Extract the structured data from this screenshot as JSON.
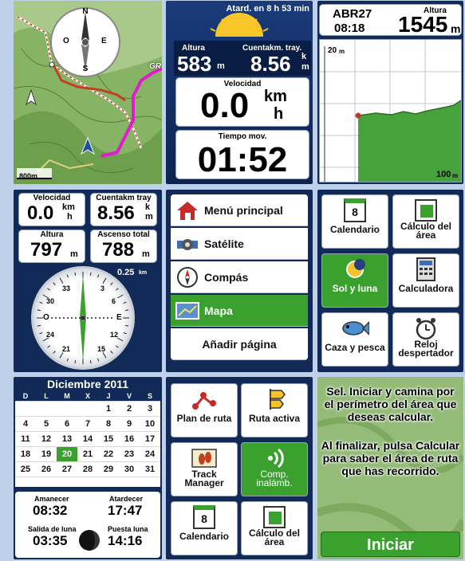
{
  "map": {
    "scale": "800m",
    "label_gr": "GR",
    "compass_n": "N",
    "compass_s": "S",
    "compass_e": "E",
    "compass_o": "O"
  },
  "trip": {
    "sunset_label": "Atard. en 8 h 53 min",
    "altitude_label": "Altura",
    "altitude_value": "583",
    "altitude_unit": "m",
    "odometer_label": "Cuentakm. tray.",
    "odometer_value": "8.56",
    "odometer_unit_top": "k",
    "odometer_unit_bottom": "m",
    "speed_label": "Velocidad",
    "speed_value": "0.0",
    "speed_unit_top": "km",
    "speed_unit_bottom": "h",
    "moving_label": "Tiempo mov.",
    "moving_value": "01:52"
  },
  "elevation": {
    "date_top": "ABR27",
    "date_bottom": "08:18",
    "altitude_label": "Altura",
    "altitude_value": "1545",
    "altitude_unit": "m",
    "y_top": "20",
    "y_top_unit": "m",
    "x_end": "100",
    "x_end_unit": "m"
  },
  "dash": {
    "speed_label": "Velocidad",
    "speed_value": "0.0",
    "speed_unit_top": "km",
    "speed_unit_bottom": "h",
    "odo_label": "Cuentakm tray",
    "odo_value": "8.56",
    "odo_unit_top": "k",
    "odo_unit_bottom": "m",
    "alt_label": "Altura",
    "alt_value": "797",
    "alt_unit": "m",
    "ascent_label": "Ascenso total",
    "ascent_value": "788",
    "ascent_unit": "m",
    "dial_distance": "0.25",
    "dial_distance_unit": "km",
    "dial_numbers": [
      "33",
      "3",
      "6",
      "E",
      "12",
      "15",
      "21",
      "24",
      "O",
      "30"
    ]
  },
  "menu": {
    "items": [
      {
        "label": "Menú principal",
        "icon": "home-icon"
      },
      {
        "label": "Satélite",
        "icon": "satellite-icon"
      },
      {
        "label": "Compás",
        "icon": "compass-icon"
      },
      {
        "label": "Mapa",
        "icon": "map-icon"
      },
      {
        "label": "Añadir página",
        "icon": ""
      }
    ],
    "active_color": "#3aa12e"
  },
  "apps1": {
    "calendar_day": "8",
    "tiles": [
      "Calendario",
      "Cálculo del área",
      "Sol y luna",
      "Calculadora",
      "Caza y pesca",
      "Reloj despertador"
    ]
  },
  "calendar": {
    "title": "Diciembre 2011",
    "weekdays": [
      "D",
      "L",
      "M",
      "X",
      "J",
      "V",
      "S"
    ],
    "weeks": [
      [
        "",
        "",
        "",
        "",
        "1",
        "2",
        "3"
      ],
      [
        "4",
        "5",
        "6",
        "7",
        "8",
        "9",
        "10"
      ],
      [
        "11",
        "12",
        "13",
        "14",
        "15",
        "16",
        "17"
      ],
      [
        "18",
        "19",
        "20",
        "21",
        "22",
        "23",
        "24"
      ],
      [
        "25",
        "26",
        "27",
        "28",
        "29",
        "30",
        "31"
      ]
    ],
    "today": "20",
    "sunrise_label": "Amanecer",
    "sunrise_value": "08:32",
    "sunset_label": "Atardecer",
    "sunset_value": "17:47",
    "moonrise_label": "Salida de luna",
    "moonrise_value": "03:35",
    "moonset_label": "Puesta luna",
    "moonset_value": "14:16"
  },
  "apps2": {
    "calendar_day": "8",
    "tiles": [
      "Plan de ruta",
      "Ruta activa",
      "Track Manager",
      "Comp. inalámb.",
      "Calendario",
      "Cálculo del área"
    ]
  },
  "area": {
    "instruction1": "Sel. Iniciar y camina por el perímetro del área que deseas calcular.",
    "instruction2": "Al finalizar, pulsa Calcular para saber el área de ruta que has recorrido.",
    "start_button": "Iniciar"
  }
}
